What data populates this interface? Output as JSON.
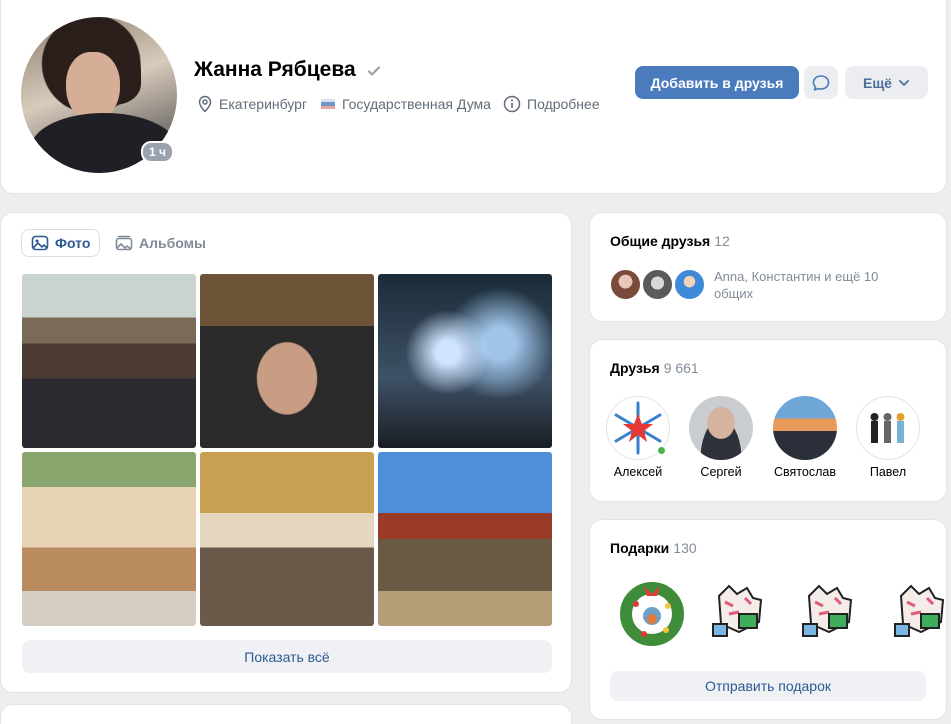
{
  "profile": {
    "name": "Жанна Рябцева",
    "online_badge": "1 ч",
    "city": "Екатеринбург",
    "workplace": "Государственная Дума",
    "details_label": "Подробнее",
    "add_friend_label": "Добавить в друзья",
    "more_label": "Ещё"
  },
  "photos": {
    "tabs": [
      {
        "label": "Фото",
        "icon": "photo-icon",
        "active": true
      },
      {
        "label": "Альбомы",
        "icon": "albums-icon",
        "active": false
      }
    ],
    "items": [
      {
        "name": "photo-meeting-hall"
      },
      {
        "name": "photo-pirate-portrait"
      },
      {
        "name": "photo-winter-lights"
      },
      {
        "name": "photo-new-year-card"
      },
      {
        "name": "photo-office-meeting"
      },
      {
        "name": "photo-construction-site"
      }
    ],
    "show_all_label": "Показать всё"
  },
  "mutual_friends": {
    "title": "Общие друзья",
    "count": "12",
    "text": "Anna, Константин и ещё 10 общих"
  },
  "friends": {
    "title": "Друзья",
    "count": "9 661",
    "items": [
      {
        "name": "Алексей",
        "online": true
      },
      {
        "name": "Сергей",
        "online": false
      },
      {
        "name": "Святослав",
        "online": false
      },
      {
        "name": "Павел",
        "online": false
      }
    ]
  },
  "gifts": {
    "title": "Подарки",
    "count": "130",
    "send_label": "Отправить подарок"
  },
  "colors": {
    "primary": "#4a7bbd",
    "link": "#2c5a91",
    "secondary_text": "#818c99",
    "background": "#edeef0",
    "online": "#4bb34b"
  }
}
